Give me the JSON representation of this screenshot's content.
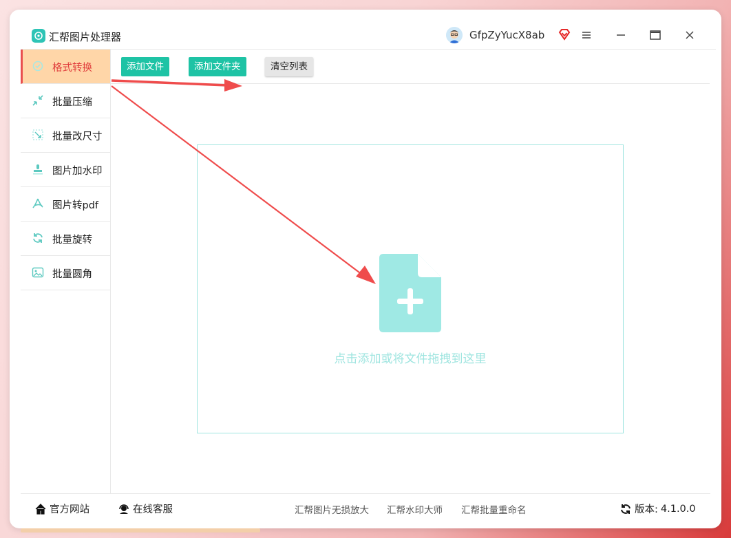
{
  "app": {
    "title": "汇帮图片处理器",
    "username": "GfpZyYucX8ab"
  },
  "sidebar": {
    "items": [
      {
        "label": "格式转换",
        "icon": "format-convert-icon",
        "active": true
      },
      {
        "label": "批量压缩",
        "icon": "compress-icon"
      },
      {
        "label": "批量改尺寸",
        "icon": "resize-icon"
      },
      {
        "label": "图片加水印",
        "icon": "watermark-icon"
      },
      {
        "label": "图片转pdf",
        "icon": "pdf-icon"
      },
      {
        "label": "批量旋转",
        "icon": "rotate-icon"
      },
      {
        "label": "批量圆角",
        "icon": "rounded-corner-icon"
      }
    ]
  },
  "toolbar": {
    "add_file": "添加文件",
    "add_folder": "添加文件夹",
    "clear_list": "清空列表"
  },
  "dropzone": {
    "hint": "点击添加或将文件拖拽到这里"
  },
  "footer": {
    "official_site": "官方网站",
    "online_support": "在线客服",
    "links": [
      "汇帮图片无损放大",
      "汇帮水印大师",
      "汇帮批量重命名"
    ],
    "version_label": "版本:",
    "version": "4.1.0.0"
  },
  "colors": {
    "accent": "#1ec3a5",
    "active_bg": "#ffd6a8",
    "active_text": "#e03c3c",
    "dropzone": "#9fe5e0",
    "arrow": "#ef4c4c"
  }
}
